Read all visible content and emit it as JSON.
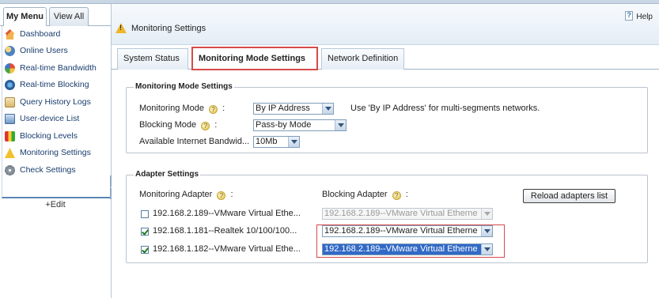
{
  "sidebar": {
    "tabs": [
      {
        "label": "My Menu",
        "active": true
      },
      {
        "label": "View All",
        "active": false
      }
    ],
    "items": [
      {
        "label": "Dashboard",
        "icon": "house-icon"
      },
      {
        "label": "Online Users",
        "icon": "users-icon"
      },
      {
        "label": "Real-time Bandwidth",
        "icon": "bandwidth-pie-icon"
      },
      {
        "label": "Real-time Blocking",
        "icon": "blocking-globe-icon"
      },
      {
        "label": "Query History Logs",
        "icon": "history-logs-icon"
      },
      {
        "label": "User-device List",
        "icon": "device-list-icon"
      },
      {
        "label": "Blocking Levels",
        "icon": "levels-icon"
      },
      {
        "label": "Monitoring Settings",
        "icon": "warning-icon"
      },
      {
        "label": "Check Settings",
        "icon": "gear-icon"
      }
    ],
    "edit_label": "+Edit"
  },
  "header": {
    "title": "Monitoring Settings",
    "help_label": "Help"
  },
  "tabs": [
    {
      "label": "System Status",
      "active": false
    },
    {
      "label": "Monitoring Mode Settings",
      "active": true
    },
    {
      "label": "Network Definition",
      "active": false
    }
  ],
  "monitoring_mode_settings": {
    "legend": "Monitoring Mode Settings",
    "monitoring_mode_label": "Monitoring Mode",
    "monitoring_mode_value": "By IP Address",
    "monitoring_mode_hint": "Use 'By IP Address' for multi-segments networks.",
    "blocking_mode_label": "Blocking Mode",
    "blocking_mode_value": "Pass-by Mode",
    "bandwidth_label": "Available Internet Bandwid...",
    "bandwidth_value": "10Mb",
    "colon": ":"
  },
  "adapter_settings": {
    "legend": "Adapter Settings",
    "monitoring_adapter_label": "Monitoring Adapter",
    "blocking_adapter_label": "Blocking Adapter",
    "colon": ":",
    "reload_button": "Reload adapters list",
    "rows": [
      {
        "checked": false,
        "monitoring": "192.168.2.189--VMware Virtual Ethe...",
        "blocking": "192.168.2.189--VMware Virtual Etherne",
        "blocking_state": "disabled"
      },
      {
        "checked": true,
        "monitoring": "192.168.1.181--Realtek 10/100/100...",
        "blocking": "192.168.2.189--VMware Virtual Etherne",
        "blocking_state": "normal"
      },
      {
        "checked": true,
        "monitoring": "192.168.1.182--VMware Virtual Ethe...",
        "blocking": "192.168.2.189--VMware Virtual Etherne",
        "blocking_state": "highlighted"
      }
    ]
  },
  "colors": {
    "accent_border": "#d64a4a",
    "link_blue": "#1a3d6e",
    "selection_blue": "#3169c6"
  }
}
